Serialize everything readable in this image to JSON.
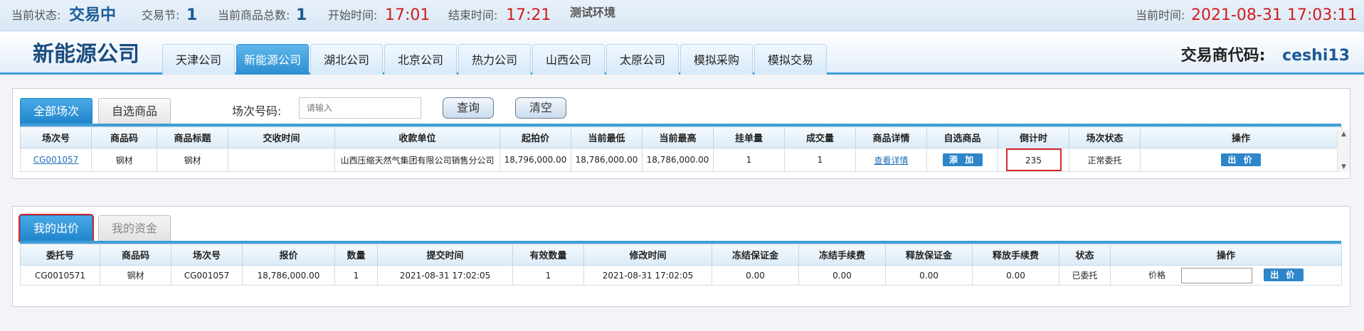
{
  "status": {
    "state_label": "当前状态:",
    "state_value": "交易中",
    "session_label": "交易节:",
    "session_value": "1",
    "total_label": "当前商品总数:",
    "total_value": "1",
    "start_label": "开始时间:",
    "start_value": "17:01",
    "end_label": "结束时间:",
    "end_value": "17:21",
    "env": "测试环境",
    "now_label": "当前时间:",
    "now_value": "2021-08-31 17:03:11"
  },
  "header": {
    "title": "新能源公司",
    "tabs": [
      "天津公司",
      "新能源公司",
      "湖北公司",
      "北京公司",
      "热力公司",
      "山西公司",
      "太原公司",
      "模拟采购",
      "模拟交易"
    ],
    "active_tab": 1,
    "trader_label": "交易商代码:",
    "trader_code": "ceshi13"
  },
  "auction": {
    "tabs": [
      "全部场次",
      "自选商品"
    ],
    "search_label": "场次号码:",
    "search_placeholder": "请输入",
    "query_button": "查询",
    "clear_button": "清空",
    "columns": [
      "场次号",
      "商品码",
      "商品标题",
      "交收时间",
      "收款单位",
      "起拍价",
      "当前最低",
      "当前最高",
      "挂单量",
      "成交量",
      "商品详情",
      "自选商品",
      "倒计时",
      "场次状态",
      "操作"
    ],
    "rows": [
      {
        "session_no": "CG001057",
        "product_code": "钢材",
        "product_title": "钢材",
        "delivery_time": "",
        "payee": "山西压缩天然气集团有限公司销售分公司",
        "start_price": "18,796,000.00",
        "current_low": "18,786,000.00",
        "current_high": "18,786,000.00",
        "orders": "1",
        "deals": "1",
        "detail": "查看详情",
        "add": "添 加",
        "countdown": "235",
        "status": "正常委托",
        "action": "出 价"
      }
    ]
  },
  "bids": {
    "tabs": [
      "我的出价",
      "我的资金"
    ],
    "columns": [
      "委托号",
      "商品码",
      "场次号",
      "报价",
      "数量",
      "提交时间",
      "有效数量",
      "修改时间",
      "冻结保证金",
      "冻结手续费",
      "释放保证金",
      "释放手续费",
      "状态",
      "操作"
    ],
    "rows": [
      {
        "order_no": "CG0010571",
        "product_code": "钢材",
        "session_no": "CG001057",
        "price": "18,786,000.00",
        "qty": "1",
        "submit_time": "2021-08-31 17:02:05",
        "valid_qty": "1",
        "modify_time": "2021-08-31 17:02:05",
        "frozen_margin": "0.00",
        "frozen_fee": "0.00",
        "release_margin": "0.00",
        "release_fee": "0.00",
        "status": "已委托",
        "price_label": "价格",
        "action": "出 价"
      }
    ]
  }
}
